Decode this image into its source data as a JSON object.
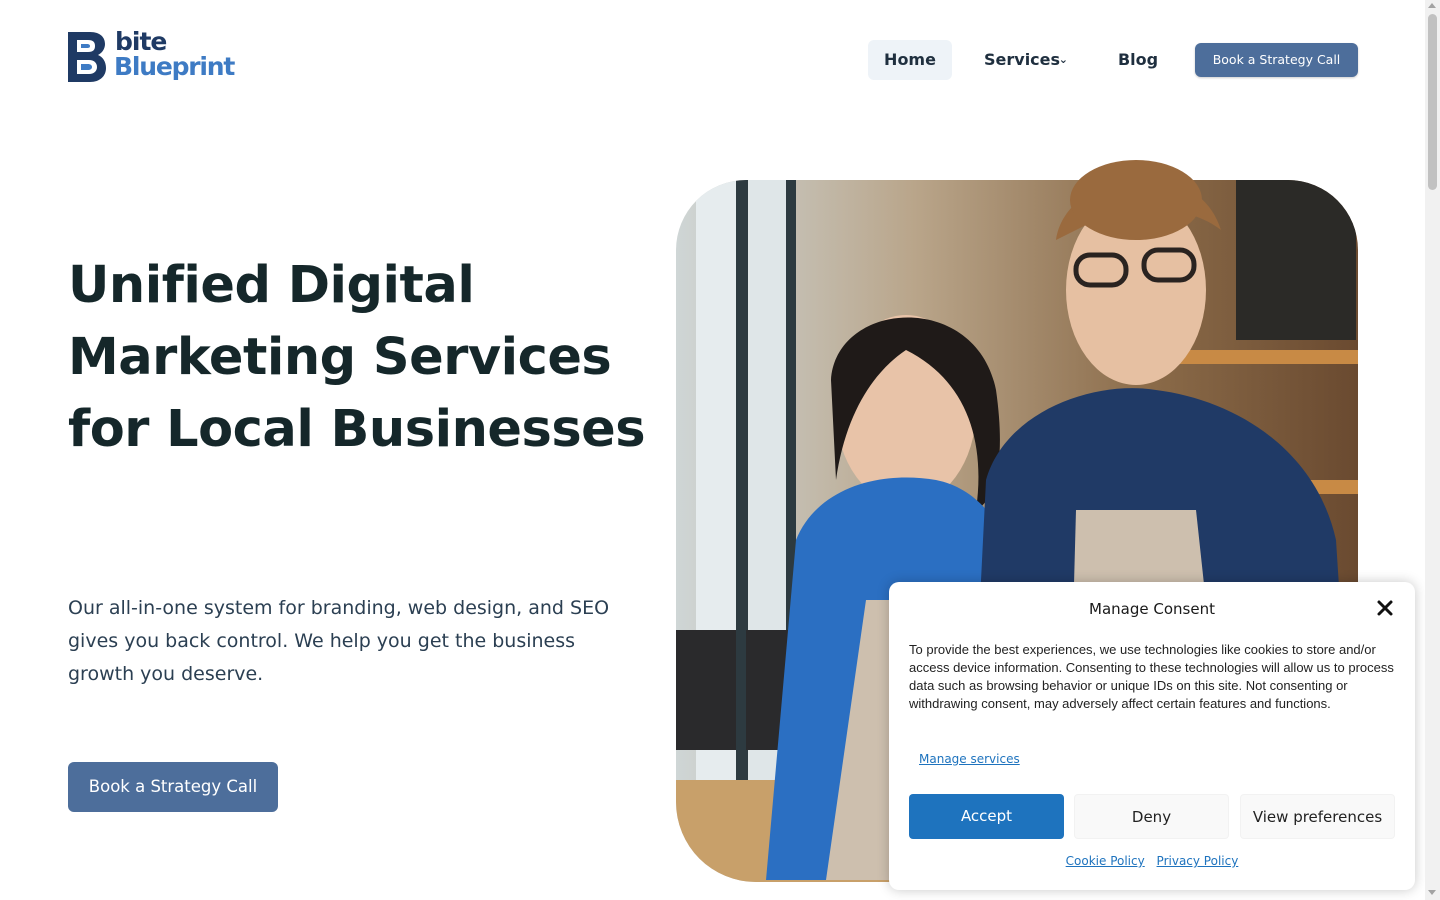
{
  "brand": {
    "line1": "bite",
    "line2": "Blueprint",
    "colors": {
      "dark": "#1f3a64",
      "light": "#3e7bc4"
    }
  },
  "nav": {
    "items": [
      {
        "label": "Home",
        "active": true
      },
      {
        "label": "Services",
        "has_dropdown": true
      },
      {
        "label": "Blog"
      }
    ],
    "cta": "Book a Strategy Call"
  },
  "hero": {
    "title": "Unified Digital Marketing Services for Local Businesses",
    "subtitle": "Our all-in-one system for branding, web design, and SEO gives you back control. We help you get the business growth you deserve.",
    "cta": "Book a Strategy Call",
    "image_icon": "cafe-staff-photo"
  },
  "consent": {
    "title": "Manage Consent",
    "body": "To provide the best experiences, we use technologies like cookies to store and/or access device information. Consenting to these technologies will allow us to process data such as browsing behavior or unique IDs on this site. Not consenting or withdrawing consent, may adversely affect certain features and functions.",
    "manage_services": "Manage services",
    "accept": "Accept",
    "deny": "Deny",
    "view_preferences": "View preferences",
    "cookie_policy": "Cookie Policy",
    "privacy_policy": "Privacy Policy",
    "accent": "#1e73be"
  },
  "colors": {
    "button": "#4d6e9b",
    "heading": "#15272a",
    "nav_active_bg": "#eef3f8"
  }
}
